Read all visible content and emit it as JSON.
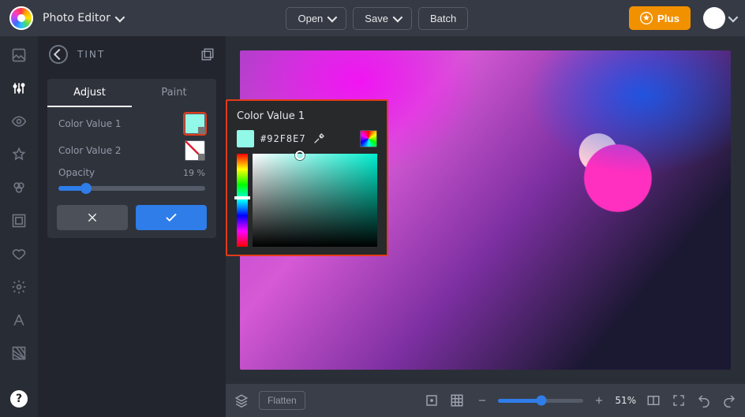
{
  "header": {
    "mode": "Photo Editor",
    "open": "Open",
    "save": "Save",
    "batch": "Batch",
    "plus": "Plus"
  },
  "rail": {
    "items": [
      "image",
      "adjust",
      "view",
      "star",
      "group",
      "frame",
      "heart",
      "gear",
      "text",
      "texture"
    ]
  },
  "panel": {
    "title": "TINT",
    "tabs": {
      "adjust": "Adjust",
      "paint": "Paint"
    },
    "cv1_label": "Color Value 1",
    "cv2_label": "Color Value 2",
    "opacity_label": "Opacity",
    "opacity_value": "19 %",
    "opacity_pct": 19,
    "color1": "#92F8E7",
    "color2": "#FFFFFF"
  },
  "popover": {
    "title": "Color Value 1",
    "hex": "#92F8E7"
  },
  "bottom": {
    "flatten": "Flatten",
    "zoom_label": "51%",
    "zoom_pct": 51
  }
}
